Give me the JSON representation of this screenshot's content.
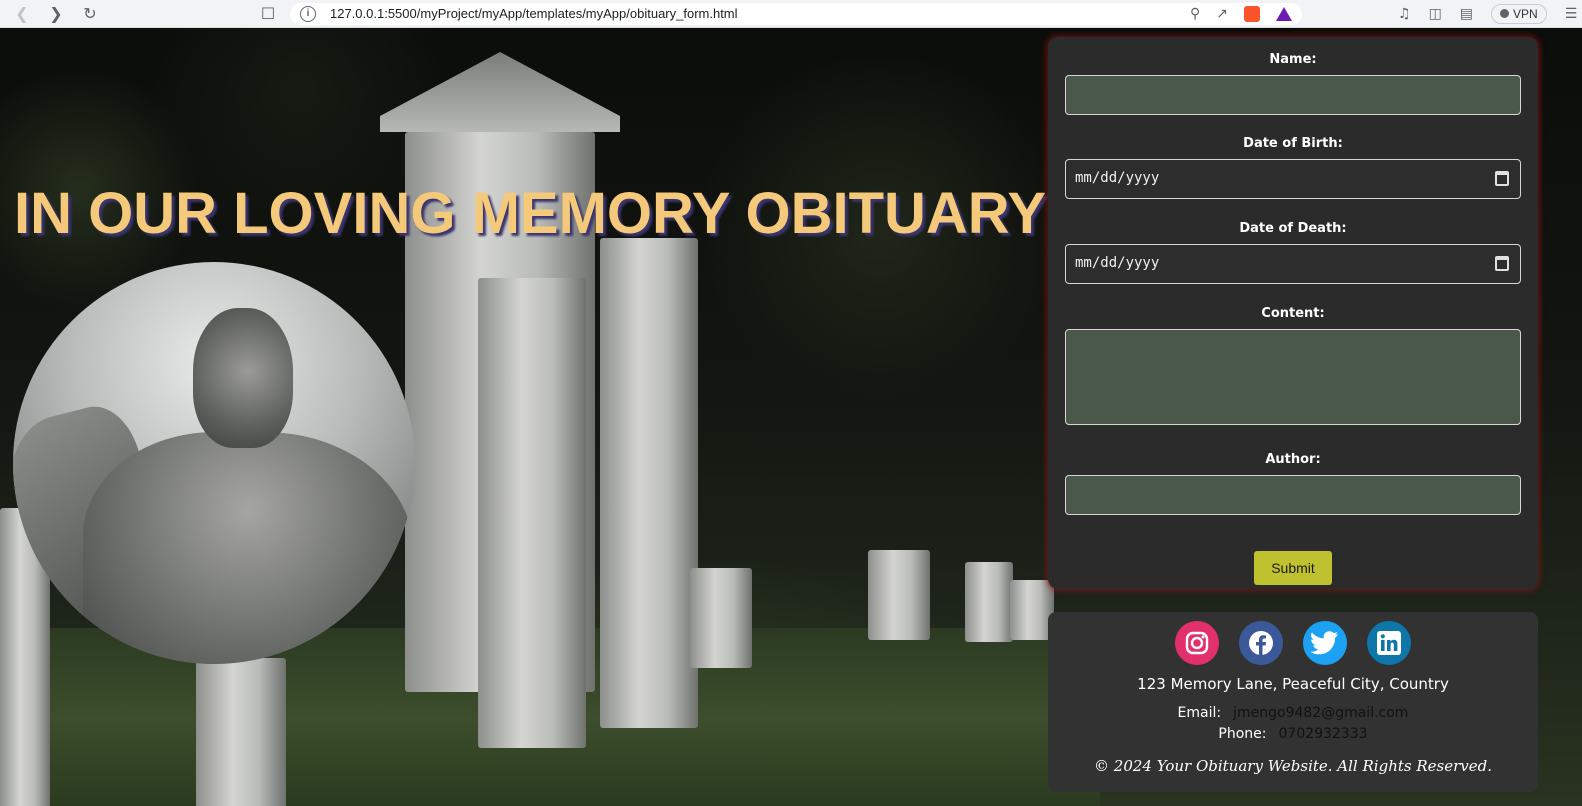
{
  "browser": {
    "url": "127.0.0.1:5500/myProject/myApp/templates/myApp/obituary_form.html",
    "vpn_label": "VPN"
  },
  "hero": {
    "title": "IN OUR LOVING MEMORY OBITUARY"
  },
  "form": {
    "name_label": "Name:",
    "name_value": "",
    "dob_label": "Date of Birth:",
    "dob_placeholder": "mm/dd/yyyy",
    "dod_label": "Date of Death:",
    "dod_placeholder": "mm/dd/yyyy",
    "content_label": "Content:",
    "content_value": "",
    "author_label": "Author:",
    "author_value": "",
    "submit_label": "Submit"
  },
  "footer": {
    "social": [
      "instagram",
      "facebook",
      "twitter",
      "linkedin"
    ],
    "address": "123 Memory Lane, Peaceful City, Country",
    "email_label": "Email:",
    "email_value": "jmengo9482@gmail.com",
    "phone_label": "Phone:",
    "phone_value": "0702932333",
    "copyright": "© 2024 Your Obituary Website. All Rights Reserved."
  },
  "colors": {
    "title": "#f5c97a",
    "input_bg": "#4a5849",
    "submit_bg": "#bfc12e",
    "panel_bg": "#2b2b2b"
  }
}
